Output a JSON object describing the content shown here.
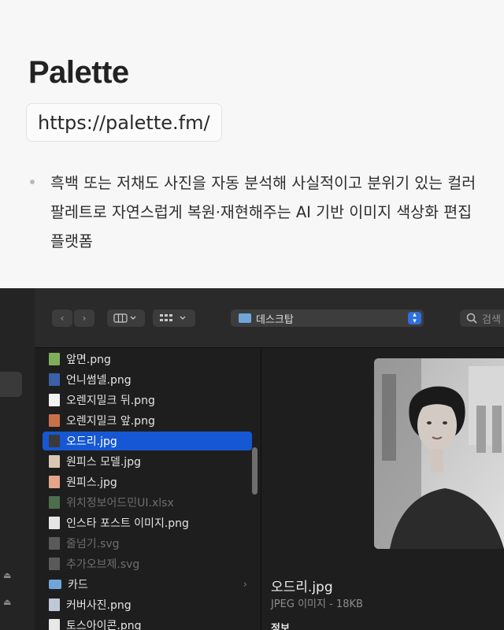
{
  "header": {
    "title": "Palette",
    "url": "https://palette.fm/",
    "description": "흑백 또는 저채도 사진을 자동 분석해 사실적이고 분위기 있는 컬러 팔레트로 자연스럽게 복원·재현해주는 AI 기반 이미지 색상화 편집 플랫폼"
  },
  "finder": {
    "toolbar": {
      "back_icon": "chevron-left-icon",
      "forward_icon": "chevron-right-icon",
      "view_icon": "column-view-icon",
      "group_icon": "grid-view-icon",
      "location": "데스크탑",
      "search_placeholder": "검색"
    },
    "files": [
      {
        "name": "앞면.png",
        "thumb": "#7fae5a",
        "state": "normal"
      },
      {
        "name": "언니썸넬.png",
        "thumb": "#3b5fa8",
        "state": "normal"
      },
      {
        "name": "오렌지밀크 뒤.png",
        "thumb": "#f2f2f2",
        "state": "normal"
      },
      {
        "name": "오렌지밀크 앞.png",
        "thumb": "#c8704a",
        "state": "normal"
      },
      {
        "name": "오드리.jpg",
        "thumb": "#3a3a3a",
        "state": "selected"
      },
      {
        "name": "원피스 모델.jpg",
        "thumb": "#d9c7b5",
        "state": "normal"
      },
      {
        "name": "원피스.jpg",
        "thumb": "#e4a58a",
        "state": "normal"
      },
      {
        "name": "위치정보어드민UI.xlsx",
        "thumb": "#4d6e4d",
        "state": "dim"
      },
      {
        "name": "인스타 포스트 이미지.png",
        "thumb": "#e6e6e6",
        "state": "normal"
      },
      {
        "name": "줄넘기.svg",
        "thumb": "#5a5a5a",
        "state": "dim"
      },
      {
        "name": "추가오브제.svg",
        "thumb": "#5a5a5a",
        "state": "dim"
      },
      {
        "name": "카드",
        "thumb": "#6fa6d9",
        "state": "folder"
      },
      {
        "name": "커버사진.png",
        "thumb": "#c0c8d8",
        "state": "normal"
      },
      {
        "name": "토스아이콘.png",
        "thumb": "#e8e8e8",
        "state": "normal"
      }
    ],
    "preview": {
      "name": "오드리.jpg",
      "subtitle": "JPEG 이미지 - 18KB",
      "info_label": "정보"
    }
  }
}
